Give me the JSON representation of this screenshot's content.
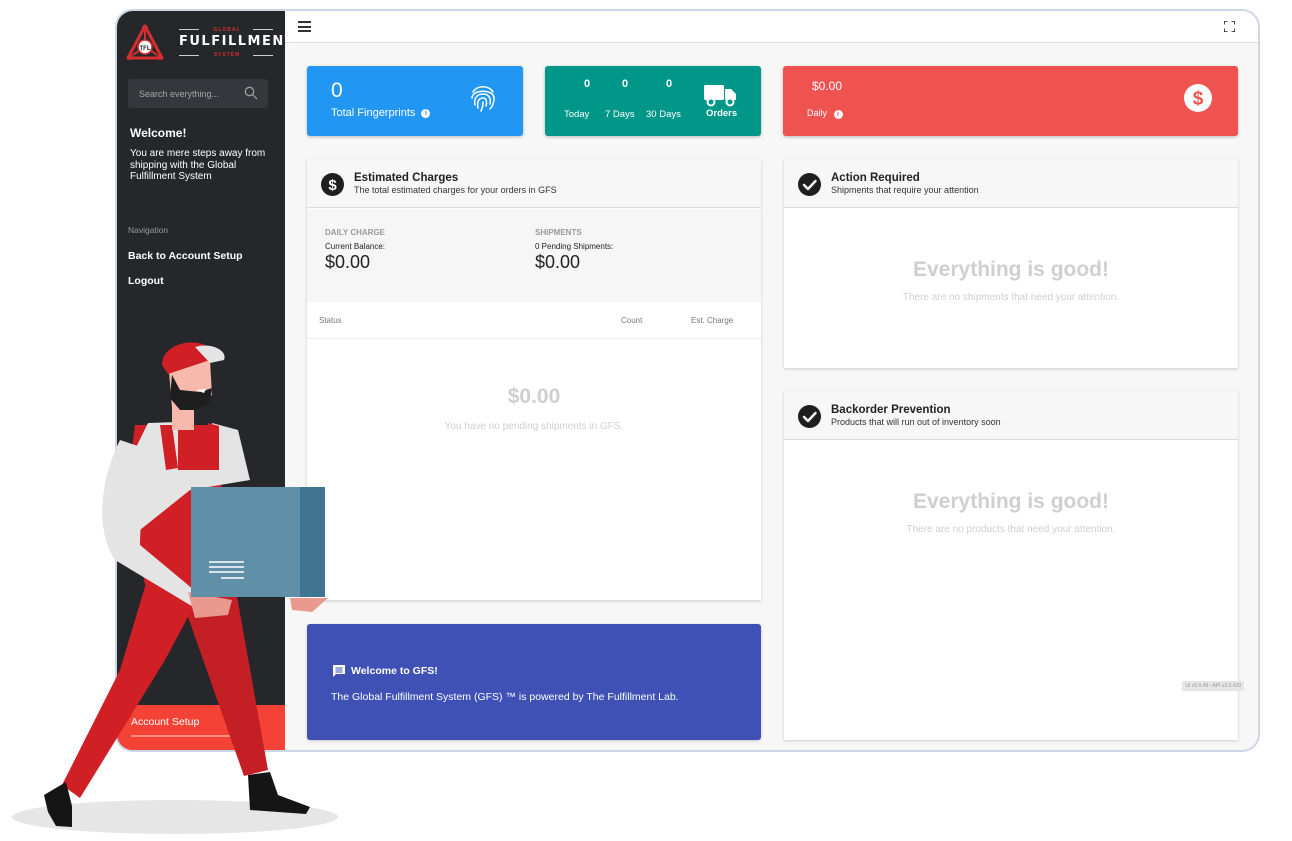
{
  "brand": {
    "logo_top": "GLOBAL",
    "logo_main": "FULFILLMENT",
    "logo_bottom": "SYSTEM",
    "logo_mark": "TFL",
    "accent": "#d32f2f"
  },
  "sidebar": {
    "search_placeholder": "Search everything...",
    "welcome_title": "Welcome!",
    "welcome_text": "You are mere steps away from shipping with the Global Fulfillment System",
    "nav_label": "Navigation",
    "nav_items": [
      {
        "label": "Back to Account Setup"
      },
      {
        "label": "Logout"
      }
    ],
    "setup_bar_label": "Account Setup",
    "setup_bar_visible_text": "count Setup"
  },
  "stats": {
    "fingerprints": {
      "value": "0",
      "label": "Total Fingerprints",
      "color": "#2196f3"
    },
    "orders": {
      "periods": [
        {
          "value": "0",
          "label": "Today"
        },
        {
          "value": "0",
          "label": "7 Days"
        },
        {
          "value": "0",
          "label": "30 Days"
        }
      ],
      "label": "Orders",
      "color": "#009688"
    },
    "daily": {
      "value": "$0.00",
      "label": "Daily",
      "color": "#ef5350"
    }
  },
  "estimated_charges": {
    "title": "Estimated Charges",
    "subtitle": "The total estimated charges for your orders in GFS",
    "daily_charge": {
      "heading": "DAILY CHARGE",
      "label": "Current Balance:",
      "value": "$0.00"
    },
    "shipments": {
      "heading": "SHIPMENTS",
      "label": "0 Pending Shipments:",
      "value": "$0.00"
    },
    "table_headers": [
      "Status",
      "Count",
      "Est. Charge"
    ],
    "empty_value": "$0.00",
    "empty_text": "You have no pending shipments in GFS."
  },
  "action_required": {
    "title": "Action Required",
    "subtitle": "Shipments that require your attention",
    "empty_title": "Everything is good!",
    "empty_text": "There are no shipments that need your attention."
  },
  "backorder": {
    "title": "Backorder Prevention",
    "subtitle": "Products that will run out of inventory soon",
    "empty_title": "Everything is good!",
    "empty_text": "There are no products that need your attention."
  },
  "welcome_card": {
    "title": "Welcome to GFS!",
    "text": "The Global Fulfillment System (GFS) ™ is powered by The Fulfillment Lab.",
    "color": "#3f51b5"
  },
  "version": "UI v2.0.48 - API v2.0.439"
}
